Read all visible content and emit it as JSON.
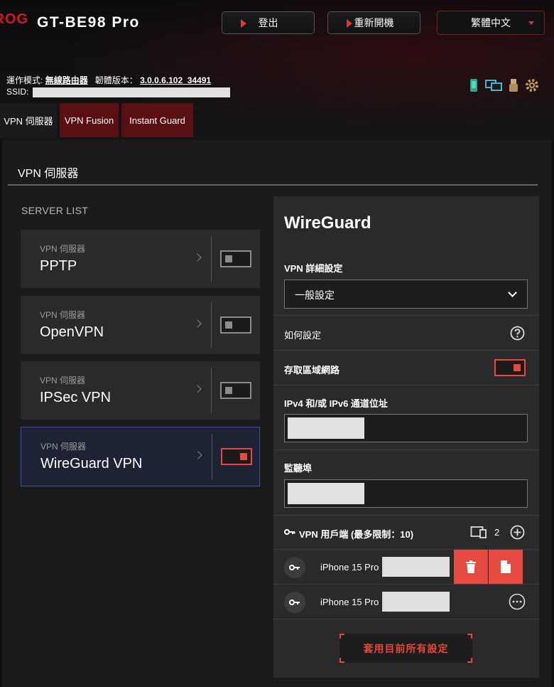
{
  "header": {
    "logo_text": "ROG",
    "model": "GT-BE98 Pro",
    "logout_label": "登出",
    "reboot_label": "重新開機",
    "language": "繁體中文",
    "op_mode_label": "運作模式:",
    "op_mode_value": "無線路由器",
    "firmware_label": "韌體版本：",
    "firmware_value": "3.0.0.6.102_34491",
    "ssid_label": "SSID:"
  },
  "tabs": [
    {
      "label": "VPN 伺服器",
      "active": true
    },
    {
      "label": "VPN Fusion",
      "active": false
    },
    {
      "label": "Instant Guard",
      "active": false
    }
  ],
  "page": {
    "title": "VPN 伺服器",
    "server_list_label": "SERVER LIST"
  },
  "servers": [
    {
      "sub": "VPN 伺服器",
      "name": "PPTP",
      "enabled": false
    },
    {
      "sub": "VPN 伺服器",
      "name": "OpenVPN",
      "enabled": false
    },
    {
      "sub": "VPN 伺服器",
      "name": "IPSec VPN",
      "enabled": false
    },
    {
      "sub": "VPN 伺服器",
      "name": "WireGuard VPN",
      "enabled": true
    }
  ],
  "config": {
    "title": "WireGuard",
    "advanced_label": "VPN 詳細設定",
    "advanced_value": "一般設定",
    "howto_label": "如何設定",
    "lan_access_label": "存取區域網路",
    "lan_access_enabled": true,
    "tunnel_label": "IPv4 和/或 IPv6 通道位址",
    "port_label": "監聽埠",
    "clients_label": "VPN 用戶端 (最多限制：10)",
    "client_count": "2",
    "clients": [
      {
        "name": "iPhone 15 Pro"
      },
      {
        "name": "iPhone 15 Pro"
      }
    ],
    "apply_label": "套用目前所有設定"
  },
  "colors": {
    "accent_red": "#e6493f",
    "active_card_border": "#3552a8",
    "panel_bg": "#1b1b1c"
  }
}
